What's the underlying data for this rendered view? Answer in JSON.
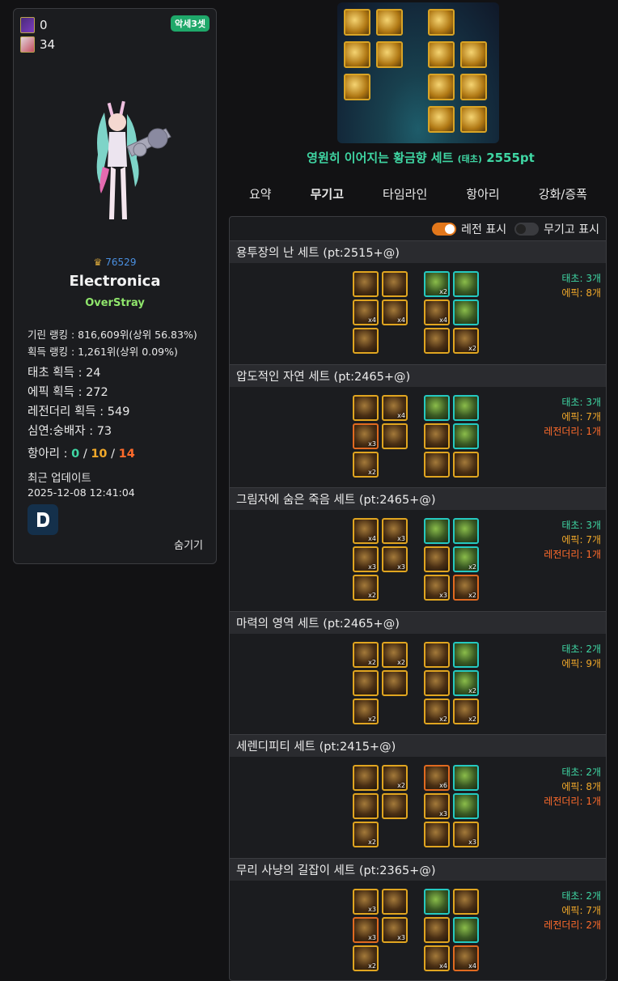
{
  "profile": {
    "currency1": "0",
    "currency2": "34",
    "badge": "악세3셋",
    "guild_emblem": "♛",
    "guild_number": "76529",
    "name": "Electronica",
    "guild_name": "OverStray",
    "stats_small": [
      "기린 랭킹 : 816,609위(상위 56.83%)",
      "획득 랭킹 : 1,261위(상위 0.09%)"
    ],
    "stats": [
      "태초 획득 : 24",
      "에픽 획득 : 272",
      "레전더리 획득 : 549",
      "심연:숭배자 : 73"
    ],
    "hangari_label": "항아리 : ",
    "hangari_sep1": " / ",
    "hangari_sep2": " / ",
    "hangari_values": [
      "0",
      "10",
      "14"
    ],
    "update_label": "최근 업데이트",
    "update_time": "2025-12-08 12:41:04",
    "hide_label": "숨기기"
  },
  "banner": {
    "title": "영원히 이어지는 황금향 세트",
    "title_sub": "(태초)",
    "title_pt": "2555pt"
  },
  "tabs": [
    "요약",
    "무기고",
    "타임라인",
    "항아리",
    "강화/증폭"
  ],
  "active_tab": "무기고",
  "toggles": {
    "legend_label": "레전 표시",
    "armory_label": "무기고 표시"
  },
  "sets": [
    {
      "title": "용투장의 난 세트 (pt:2515+@)",
      "counts": [
        {
          "type": "t",
          "text": "태초: 3개"
        },
        {
          "type": "e",
          "text": "에픽: 8개"
        }
      ],
      "left": [
        [
          "ep",
          ""
        ],
        [
          "ep",
          ""
        ],
        [
          "ep",
          "x4"
        ],
        [
          "ep",
          "x4"
        ],
        [
          "ep",
          ""
        ]
      ],
      "right": [
        [
          "tc",
          "x2"
        ],
        [
          "tc",
          ""
        ],
        [
          "ep",
          "x4"
        ],
        [
          "tc",
          ""
        ],
        [
          "ep",
          ""
        ],
        [
          "ep",
          "x2"
        ]
      ]
    },
    {
      "title": "압도적인 자연 세트 (pt:2465+@)",
      "counts": [
        {
          "type": "t",
          "text": "태초: 3개"
        },
        {
          "type": "e",
          "text": "에픽: 7개"
        },
        {
          "type": "l",
          "text": "레전더리: 1개"
        }
      ],
      "left": [
        [
          "ep",
          ""
        ],
        [
          "ep",
          "x4"
        ],
        [
          "lg",
          "x3"
        ],
        [
          "ep",
          ""
        ],
        [
          "ep",
          "x2"
        ]
      ],
      "right": [
        [
          "tc",
          ""
        ],
        [
          "tc",
          ""
        ],
        [
          "ep",
          ""
        ],
        [
          "tc",
          ""
        ],
        [
          "ep",
          ""
        ],
        [
          "ep",
          ""
        ]
      ]
    },
    {
      "title": "그림자에 숨은 죽음 세트 (pt:2465+@)",
      "counts": [
        {
          "type": "t",
          "text": "태초: 3개"
        },
        {
          "type": "e",
          "text": "에픽: 7개"
        },
        {
          "type": "l",
          "text": "레전더리: 1개"
        }
      ],
      "left": [
        [
          "ep",
          "x4"
        ],
        [
          "ep",
          "x3"
        ],
        [
          "ep",
          "x3"
        ],
        [
          "ep",
          "x3"
        ],
        [
          "ep",
          "x2"
        ]
      ],
      "right": [
        [
          "tc",
          ""
        ],
        [
          "tc",
          ""
        ],
        [
          "ep",
          ""
        ],
        [
          "tc",
          "x2"
        ],
        [
          "ep",
          "x3"
        ],
        [
          "lg",
          "x2"
        ]
      ]
    },
    {
      "title": "마력의 영역 세트 (pt:2465+@)",
      "counts": [
        {
          "type": "t",
          "text": "태초: 2개"
        },
        {
          "type": "e",
          "text": "에픽: 9개"
        }
      ],
      "left": [
        [
          "ep",
          "x2"
        ],
        [
          "ep",
          "x2"
        ],
        [
          "ep",
          ""
        ],
        [
          "ep",
          ""
        ],
        [
          "ep",
          "x2"
        ]
      ],
      "right": [
        [
          "ep",
          ""
        ],
        [
          "tc",
          ""
        ],
        [
          "ep",
          ""
        ],
        [
          "tc",
          "x2"
        ],
        [
          "ep",
          "x2"
        ],
        [
          "ep",
          "x2"
        ]
      ]
    },
    {
      "title": "세렌디피티 세트 (pt:2415+@)",
      "counts": [
        {
          "type": "t",
          "text": "태초: 2개"
        },
        {
          "type": "e",
          "text": "에픽: 8개"
        },
        {
          "type": "l",
          "text": "레전더리: 1개"
        }
      ],
      "left": [
        [
          "ep",
          ""
        ],
        [
          "ep",
          "x2"
        ],
        [
          "ep",
          ""
        ],
        [
          "ep",
          ""
        ],
        [
          "ep",
          "x2"
        ]
      ],
      "right": [
        [
          "lg",
          "x6"
        ],
        [
          "tc",
          ""
        ],
        [
          "ep",
          "x3"
        ],
        [
          "tc",
          ""
        ],
        [
          "ep",
          ""
        ],
        [
          "ep",
          "x3"
        ]
      ]
    },
    {
      "title": "무리 사냥의 길잡이 세트 (pt:2365+@)",
      "counts": [
        {
          "type": "t",
          "text": "태초: 2개"
        },
        {
          "type": "e",
          "text": "에픽: 7개"
        },
        {
          "type": "l",
          "text": "레전더리: 2개"
        }
      ],
      "left": [
        [
          "ep",
          "x3"
        ],
        [
          "ep",
          ""
        ],
        [
          "lg",
          "x3"
        ],
        [
          "ep",
          "x3"
        ],
        [
          "ep",
          "x2"
        ]
      ],
      "right": [
        [
          "tc",
          ""
        ],
        [
          "ep",
          ""
        ],
        [
          "ep",
          ""
        ],
        [
          "tc",
          ""
        ],
        [
          "ep",
          "x4"
        ],
        [
          "lg",
          "x4"
        ]
      ]
    }
  ]
}
